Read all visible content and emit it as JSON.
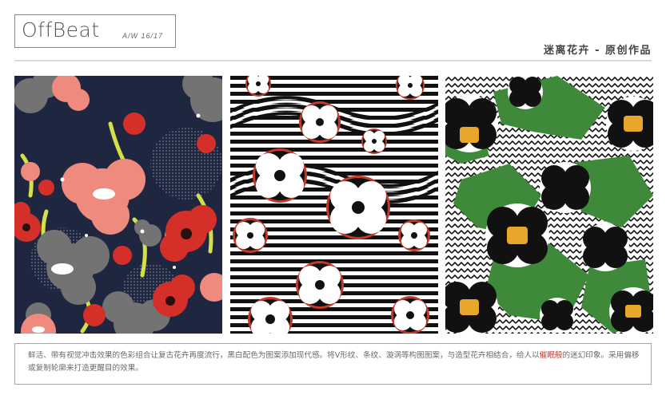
{
  "header": {
    "logo": "OffBeat",
    "season": "A/W 16/17",
    "title": "迷离花卉 - 原创作品"
  },
  "patterns": [
    {
      "name": "floral-pattern-navy"
    },
    {
      "name": "floral-pattern-stripes"
    },
    {
      "name": "floral-pattern-green"
    }
  ],
  "description": {
    "part1": "鲜活、带有视觉冲击效果的色彩组合让复古花卉再度流行，黑白配色为图案添加现代感。将V形纹、条纹、漩涡等构图图案，与造型花卉相结合，给人以",
    "highlight": "催眠般",
    "part2": "的迷幻印象。采用偏移或复制轮廓来打造更醒目的效果。"
  },
  "colors": {
    "navy": "#1f2740",
    "coral": "#ef8a7e",
    "red": "#d52f2a",
    "grey": "#737373",
    "lime": "#d4e04a",
    "green": "#3e8a3a",
    "yellow": "#e8a72a",
    "black": "#111111"
  }
}
